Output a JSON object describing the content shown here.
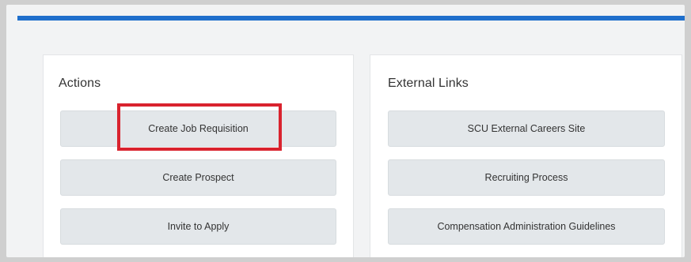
{
  "header": {
    "accent_color": "#1f6fcc"
  },
  "actions": {
    "title": "Actions",
    "items": [
      {
        "label": "Create Job Requisition"
      },
      {
        "label": "Create Prospect"
      },
      {
        "label": "Invite to Apply"
      }
    ]
  },
  "external_links": {
    "title": "External Links",
    "items": [
      {
        "label": "SCU External Careers Site"
      },
      {
        "label": "Recruiting Process"
      },
      {
        "label": "Compensation Administration Guidelines"
      }
    ]
  },
  "annotation": {
    "highlight_color": "#d9232e",
    "target": "Create Job Requisition"
  }
}
